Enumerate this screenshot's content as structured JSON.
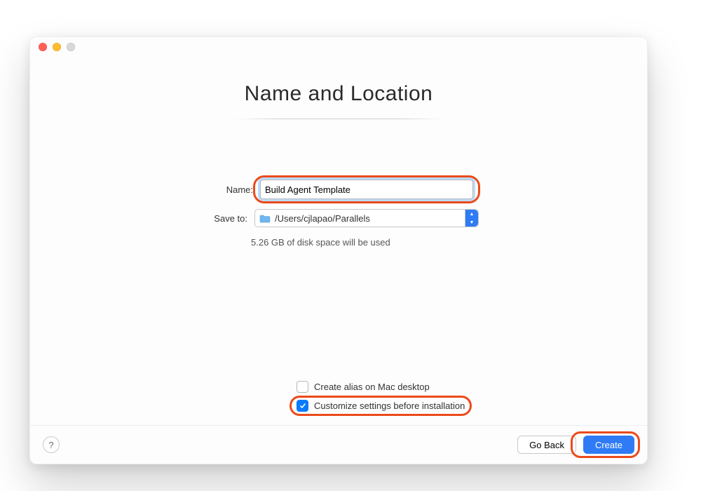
{
  "window": {
    "title": "Name and Location"
  },
  "form": {
    "name_label": "Name:",
    "name_value": "Build Agent Template",
    "save_to_label": "Save to:",
    "save_to_path": "/Users/cjlapao/Parallels",
    "disk_note": "5.26 GB of disk space will be used"
  },
  "checks": {
    "alias_label": "Create alias on Mac desktop",
    "alias_checked": false,
    "customize_label": "Customize settings before installation",
    "customize_checked": true
  },
  "footer": {
    "help_symbol": "?",
    "go_back": "Go Back",
    "create": "Create"
  },
  "icons": {
    "folder": "folder-icon",
    "stepper_up": "▲",
    "stepper_down": "▼"
  },
  "highlight_color": "#ec4a1c",
  "accent_color": "#2f7bf6"
}
